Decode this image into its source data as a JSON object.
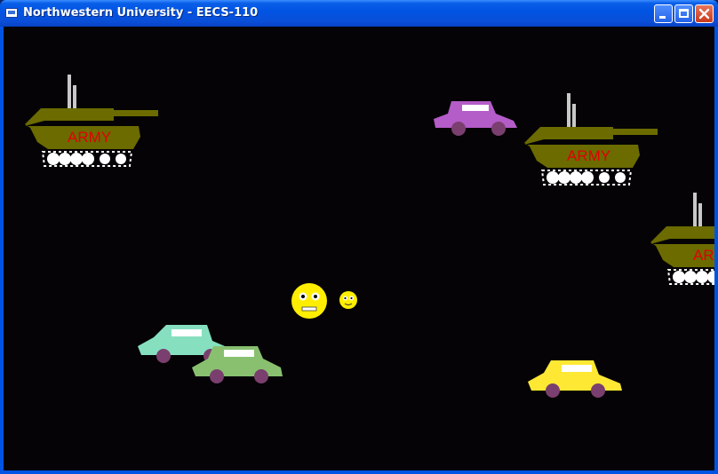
{
  "window": {
    "title": "Northwestern University - EECS-110",
    "controls": [
      "minimize",
      "maximize",
      "close"
    ]
  },
  "game": {
    "background": "#050305",
    "sprites": {
      "tanks": [
        {
          "label": "ARMY",
          "body_color": "#6b6b00",
          "label_color": "#e00000"
        },
        {
          "label": "ARMY",
          "body_color": "#6b6b00",
          "label_color": "#e00000"
        },
        {
          "label": "ARMY",
          "body_color": "#6b6b00",
          "label_color": "#e00000"
        }
      ],
      "cars": [
        {
          "color": "#b45cc8"
        },
        {
          "color": "#86e0c0"
        },
        {
          "color": "#88c070"
        },
        {
          "color": "#ffe833"
        }
      ],
      "smileys": [
        {
          "color": "#ffee00"
        },
        {
          "color": "#ffee00"
        }
      ]
    }
  }
}
